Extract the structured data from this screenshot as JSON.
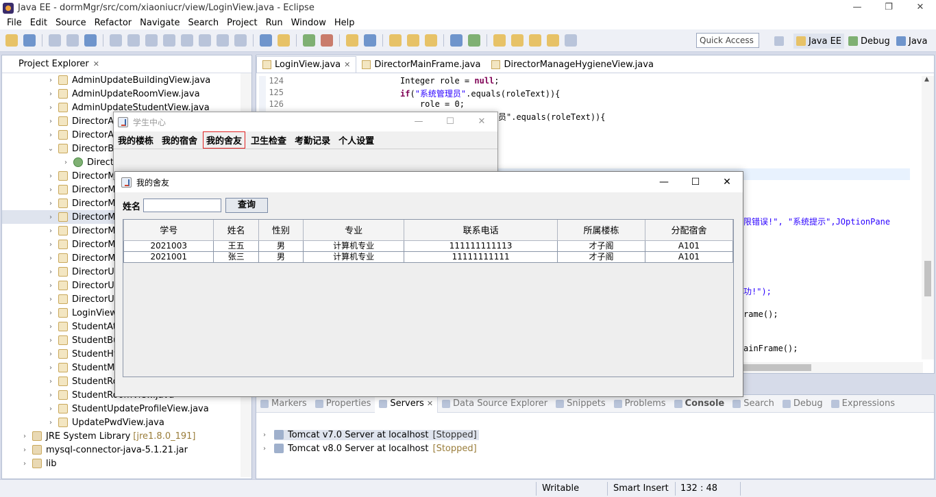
{
  "eclipse": {
    "title": "Java EE - dormMgr/src/com/xiaoniucr/view/LoginView.java - Eclipse",
    "window_controls": {
      "minimize": "—",
      "restore": "❐",
      "close": "✕"
    },
    "menu": [
      "File",
      "Edit",
      "Source",
      "Refactor",
      "Navigate",
      "Search",
      "Project",
      "Run",
      "Window",
      "Help"
    ],
    "quick_access": "Quick Access",
    "perspectives": [
      "Java EE",
      "Debug",
      "Java"
    ]
  },
  "explorer": {
    "title": "Project Explorer",
    "items": [
      {
        "label": "AdminUpdateBuildingView.java",
        "chev": "›"
      },
      {
        "label": "AdminUpdateRoomView.java",
        "chev": "›"
      },
      {
        "label": "AdminUpdateStudentView.java",
        "chev": "›"
      },
      {
        "label": "DirectorAc",
        "chev": "›"
      },
      {
        "label": "DirectorAc",
        "chev": "›"
      },
      {
        "label": "DirectorBu",
        "chev": "⌄"
      },
      {
        "label": "Directo",
        "chev": "›",
        "child": true
      },
      {
        "label": "DirectorM",
        "chev": "›"
      },
      {
        "label": "DirectorM",
        "chev": "›"
      },
      {
        "label": "DirectorM",
        "chev": "›"
      },
      {
        "label": "DirectorM",
        "chev": "›",
        "selected": true
      },
      {
        "label": "DirectorM",
        "chev": "›"
      },
      {
        "label": "DirectorM",
        "chev": "›"
      },
      {
        "label": "DirectorM",
        "chev": "›"
      },
      {
        "label": "DirectorUp",
        "chev": "›"
      },
      {
        "label": "DirectorUp",
        "chev": "›"
      },
      {
        "label": "DirectorUp",
        "chev": "›"
      },
      {
        "label": "LoginView",
        "chev": "›"
      },
      {
        "label": "StudentAtt",
        "chev": "›"
      },
      {
        "label": "StudentBu",
        "chev": "›"
      },
      {
        "label": "StudentHyg",
        "chev": "›"
      },
      {
        "label": "StudentMa",
        "chev": "›"
      },
      {
        "label": "StudentRoo",
        "chev": "›"
      },
      {
        "label": "StudentRoomView.java",
        "chev": "›"
      },
      {
        "label": "StudentUpdateProfileView.java",
        "chev": "›"
      },
      {
        "label": "UpdatePwdView.java",
        "chev": "›"
      }
    ],
    "libs": [
      {
        "label": "JRE System Library",
        "decoration": "[jre1.8.0_191]"
      },
      {
        "label": "mysql-connector-java-5.1.21.jar",
        "decoration": ""
      },
      {
        "label": "lib",
        "decoration": ""
      }
    ]
  },
  "editor": {
    "tabs": [
      "LoginView.java",
      "DirectorMainFrame.java",
      "DirectorManageHygieneView.java"
    ],
    "lines": [
      {
        "num": "124",
        "kw1": "",
        "text": "Integer role = ",
        "kw2": "null",
        "tail": ";"
      },
      {
        "num": "125",
        "kw1": "if",
        "text": "(",
        "str": "\"系统管理员\"",
        "tail": ".equals(roleText)){"
      },
      {
        "num": "126",
        "kw1": "",
        "text": "    role = 0;",
        "tail": ""
      }
    ],
    "fragments": {
      "f1": "员\".equals(roleText)){",
      "f2": "\"系统提示\",JOptionPane",
      "f2_prefix": "限错误!\", ",
      "f3": "功!\");",
      "f4": "rame();",
      "f5": "ainFrame();"
    }
  },
  "bottom": {
    "tabs": [
      "Markers",
      "Properties",
      "Servers",
      "Data Source Explorer",
      "Snippets",
      "Problems",
      "Console",
      "Search",
      "Debug",
      "Expressions"
    ],
    "servers": [
      {
        "name": "Tomcat v7.0 Server at localhost",
        "state": "[Stopped]"
      },
      {
        "name": "Tomcat v8.0 Server at localhost",
        "state": "[Stopped]"
      }
    ]
  },
  "status": {
    "writable": "Writable",
    "insert": "Smart Insert",
    "position": "132 : 48"
  },
  "student_center": {
    "title": "学生中心",
    "menu": [
      "我的楼栋",
      "我的宿舍",
      "我的舍友",
      "卫生检查",
      "考勤记录",
      "个人设置"
    ],
    "active_menu": "我的舍友"
  },
  "roommates": {
    "title": "我的舍友",
    "search_label": "姓名",
    "search_value": "",
    "query_button": "查询",
    "columns": [
      "学号",
      "姓名",
      "性别",
      "专业",
      "联系电话",
      "所属楼栋",
      "分配宿舍"
    ],
    "rows": [
      [
        "2021003",
        "王五",
        "男",
        "计算机专业",
        "111111111113",
        "才子阁",
        "A101"
      ],
      [
        "2021001",
        "张三",
        "男",
        "计算机专业",
        "11111111111",
        "才子阁",
        "A101"
      ]
    ]
  }
}
